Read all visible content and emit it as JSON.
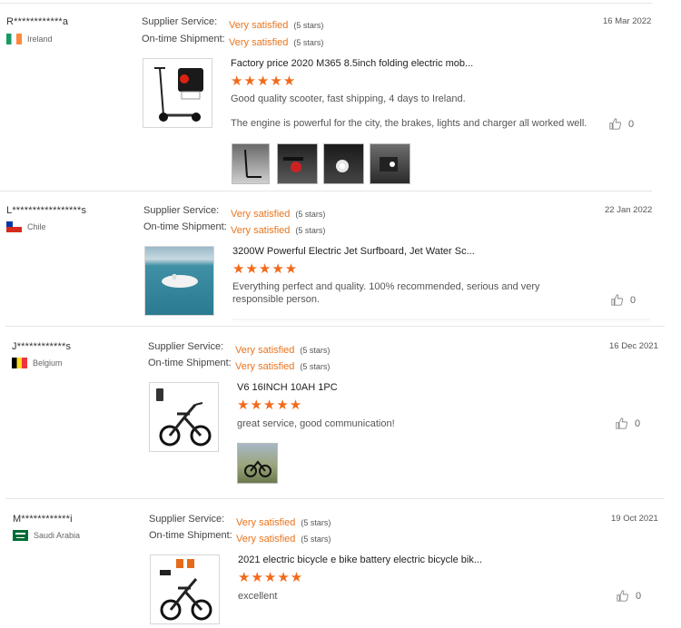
{
  "labels": {
    "supplier": "Supplier Service:",
    "shipment": "On-time Shipment:"
  },
  "reviews": [
    {
      "user": "R************a",
      "country": "Ireland",
      "supplier_value": "Very satisfied",
      "supplier_stars": "(5 stars)",
      "shipment_value": "Very satisfied",
      "shipment_stars": "(5 stars)",
      "date": "16 Mar 2022",
      "product_title": "Factory price 2020 M365 8.5inch folding electric mob...",
      "rating": "★★★★★",
      "text1": "Good quality scooter, fast shipping, 4 days to Ireland.",
      "text2": "The engine is powerful for the city, the brakes, lights and charger all worked well.",
      "likes": "0"
    },
    {
      "user": "L*****************s",
      "country": "Chile",
      "supplier_value": "Very satisfied",
      "supplier_stars": "(5 stars)",
      "shipment_value": "Very satisfied",
      "shipment_stars": "(5 stars)",
      "date": "22 Jan 2022",
      "product_title": "3200W Powerful Electric Jet Surfboard, Jet Water Sc...",
      "rating": "★★★★★",
      "text1": "Everything perfect and quality. 100% recommended, serious and very responsible person.",
      "likes": "0"
    },
    {
      "user": "J************s",
      "country": "Belgium",
      "supplier_value": "Very satisfied",
      "supplier_stars": "(5 stars)",
      "shipment_value": "Very satisfied",
      "shipment_stars": "(5 stars)",
      "date": "16 Dec 2021",
      "product_title": "V6 16INCH 10AH 1PC",
      "rating": "★★★★★",
      "text1": "great service, good communication!",
      "likes": "0"
    },
    {
      "user": "M************i",
      "country": "Saudi Arabia",
      "supplier_value": "Very satisfied",
      "supplier_stars": "(5 stars)",
      "shipment_value": "Very satisfied",
      "shipment_stars": "(5 stars)",
      "date": "19 Oct 2021",
      "product_title": "2021 electric bicycle e bike battery electric bicycle bik...",
      "rating": "★★★★★",
      "text1": "excellent",
      "likes": "0"
    }
  ],
  "icons": {
    "like": "thumbs-up-icon",
    "flags": [
      "ireland-flag-icon",
      "chile-flag-icon",
      "belgium-flag-icon",
      "saudi-arabia-flag-icon"
    ]
  },
  "colors": {
    "accent": "#e8741e",
    "stars": "#f26a1b",
    "divider": "#e6e6e6"
  }
}
